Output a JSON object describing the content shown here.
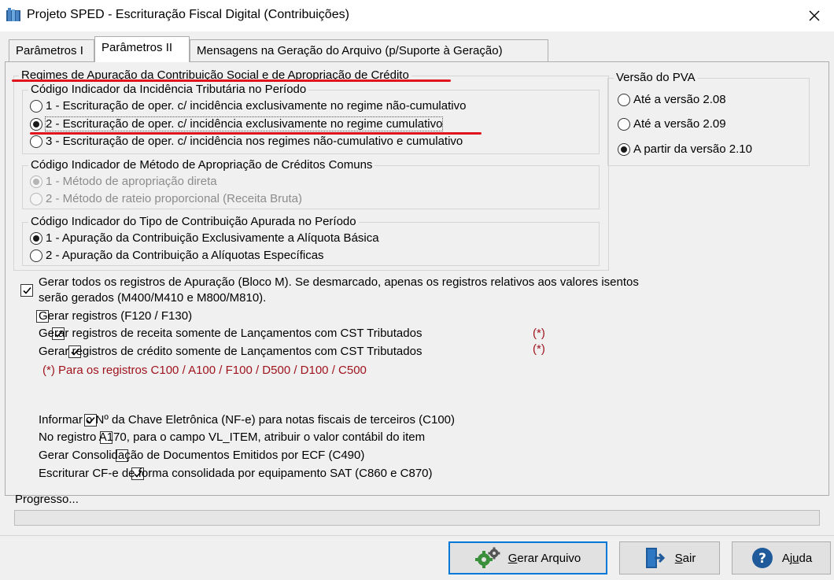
{
  "window": {
    "title": "Projeto SPED - Escrituração Fiscal Digital (Contribuições)",
    "close_glyph": "✕"
  },
  "tabs": [
    {
      "label": "Parâmetros I"
    },
    {
      "label": "Parâmetros II"
    },
    {
      "label": "Mensagens na Geração do Arquivo (p/Suporte à Geração)"
    }
  ],
  "regimes": {
    "title": "Regimes de Apuração da Contribuição Social e de Apropriação de Crédito",
    "incidencia": {
      "title": "Código Indicador da Incidência Tributária no Período",
      "options": [
        "1 - Escrituração de oper. c/ incidência exclusivamente no regime não-cumulativo",
        "2 - Escrituração de oper. c/ incidência exclusivamente no regime cumulativo",
        "3 - Escrituração de oper. c/ incidência nos regimes não-cumulativo e cumulativo"
      ],
      "selected": 2
    },
    "metodo": {
      "title": "Código Indicador de Método de Apropriação de Créditos Comuns",
      "options": [
        "1 - Método de apropriação direta",
        "2 - Método de rateio proporcional (Receita Bruta)"
      ],
      "enabled": false
    },
    "tipo": {
      "title": "Código Indicador do Tipo de Contribuição Apurada no Período",
      "options": [
        "1 - Apuração da Contribuição Exclusivamente a Alíquota Básica",
        "2 - Apuração da Contribuição a Alíquotas Específicas"
      ],
      "selected": 1
    }
  },
  "versao": {
    "title": "Versão do PVA",
    "options": [
      "Até a versão 2.08",
      "Até a versão 2.09",
      "A partir da versão 2.10"
    ],
    "selected": 3
  },
  "checks_a": [
    {
      "label_line1": "Gerar todos os registros de Apuração (Bloco M). Se desmarcado, apenas os registros relativos aos valores isentos",
      "label_line2": "serão gerados (M400/M410 e M800/M810).",
      "checked": true
    },
    {
      "label": "Gerar registros (F120 / F130)",
      "checked": false
    },
    {
      "label": "Gerar registros de receita somente de Lançamentos com CST Tributados",
      "checked": true,
      "marker": "(*)"
    },
    {
      "label": "Gerar registros de crédito somente de Lançamentos com CST Tributados",
      "checked": true,
      "marker": "(*)"
    }
  ],
  "footnote": "(*) Para os registros C100 / A100 / F100 / D500 / D100 / C500",
  "checks_b": [
    {
      "label": "Informar o Nº da Chave Eletrônica (NF-e) para notas fiscais de terceiros (C100)",
      "checked": true
    },
    {
      "label": "No registro A170, para o campo VL_ITEM, atribuir o valor contábil do item",
      "checked": false
    },
    {
      "label": "Gerar Consolidação de Documentos Emitidos por ECF (C490)",
      "checked": false
    },
    {
      "label": "Escriturar CF-e de forma consolidada por equipamento SAT (C860 e C870)",
      "checked": true
    }
  ],
  "progress": {
    "label": "Progresso...",
    "value": 0
  },
  "buttons": {
    "gerar": {
      "label_first": "G",
      "label_rest": "erar Arquivo"
    },
    "sair": {
      "label_first": "S",
      "label_rest": "air"
    },
    "ajuda": {
      "label_pre": "Aj",
      "label_u": "u",
      "label_post": "da"
    }
  },
  "colors": {
    "annotation_red": "#e0141e",
    "note_red": "#a0141e",
    "focus_blue": "#0078d7"
  }
}
